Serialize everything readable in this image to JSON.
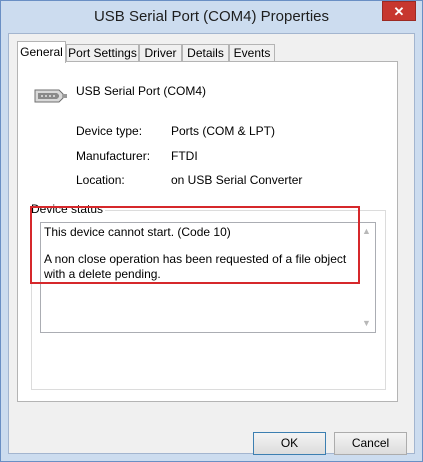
{
  "window": {
    "title": "USB Serial Port (COM4) Properties",
    "close_glyph": "✕"
  },
  "tabs": [
    {
      "label": "General",
      "active": true
    },
    {
      "label": "Port Settings",
      "active": false
    },
    {
      "label": "Driver",
      "active": false
    },
    {
      "label": "Details",
      "active": false
    },
    {
      "label": "Events",
      "active": false
    }
  ],
  "general": {
    "device_icon": "serial-port-connector-icon",
    "device_name": "USB Serial Port (COM4)",
    "properties": [
      {
        "label": "Device type:",
        "value": "Ports (COM & LPT)"
      },
      {
        "label": "Manufacturer:",
        "value": "FTDI"
      },
      {
        "label": "Location:",
        "value": "on USB Serial Converter"
      }
    ],
    "device_status": {
      "label": "Device status",
      "line1": "This device cannot start. (Code 10)",
      "line2": "A non close operation has been requested of a file object with a delete pending."
    }
  },
  "buttons": {
    "ok": "OK",
    "cancel": "Cancel"
  },
  "colors": {
    "highlight": "#d6282b",
    "close_button": "#c7372f",
    "frame": "#ccdcef"
  }
}
